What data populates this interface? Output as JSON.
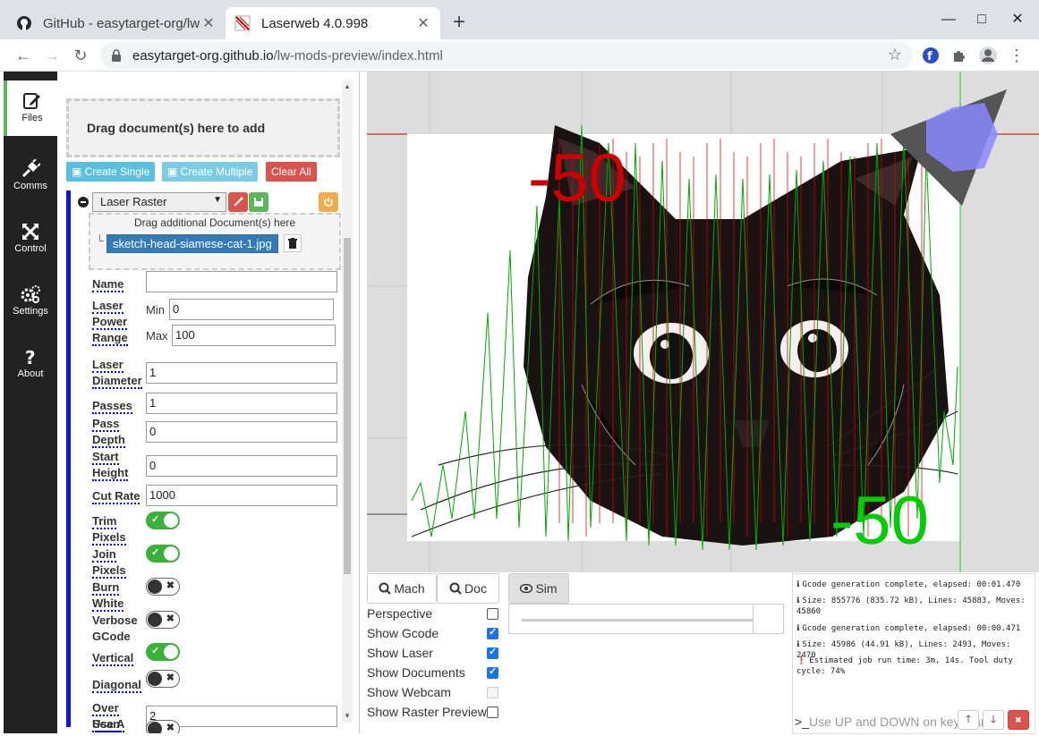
{
  "browser": {
    "tabs": [
      {
        "title": "GitHub - easytarget-org/lw-mods-preview",
        "active": false
      },
      {
        "title": "Laserweb 4.0.998",
        "active": true
      }
    ],
    "address_host": "easytarget-org.github.io",
    "address_path": "/lw-mods-preview/index.html"
  },
  "sidebar": {
    "items": [
      {
        "label": "Files",
        "icon": "file-edit-icon"
      },
      {
        "label": "Comms",
        "icon": "plug-icon"
      },
      {
        "label": "Control",
        "icon": "arrows-icon"
      },
      {
        "label": "Settings",
        "icon": "gears-icon"
      },
      {
        "label": "About",
        "icon": "question-icon"
      }
    ]
  },
  "files": {
    "dropzone_text": "Drag document(s) here to add",
    "create_single": "Create Single",
    "create_multiple": "Create Multiple",
    "clear_all": "Clear All"
  },
  "operation": {
    "type": "Laser Raster",
    "doc_drop_text": "Drag additional Document(s) here",
    "document": "sketch-head-siamese-cat-1.jpg",
    "fields": {
      "name": {
        "label": "Name",
        "value": ""
      },
      "laser_power_range": {
        "label_1": "Laser",
        "label_2": "Power",
        "label_3": "Range",
        "min_label": "Min",
        "min": "0",
        "max_label": "Max",
        "max": "100"
      },
      "laser_diameter": {
        "label_1": "Laser",
        "label_2": "Diameter",
        "value": "1"
      },
      "passes": {
        "label": "Passes",
        "value": "1"
      },
      "pass_depth": {
        "label_1": "Pass",
        "label_2": "Depth",
        "value": "0"
      },
      "start_height": {
        "label_1": "Start",
        "label_2": "Height",
        "value": "0"
      },
      "cut_rate": {
        "label": "Cut Rate",
        "value": "1000"
      },
      "trim_pixels": {
        "label_1": "Trim",
        "label_2": "Pixels",
        "on": true
      },
      "join_pixels": {
        "label_1": "Join",
        "label_2": "Pixels",
        "on": true
      },
      "burn_white": {
        "label_1": "Burn",
        "label_2": "White",
        "on": false
      },
      "verbose_gcode": {
        "label_1": "Verbose",
        "label_2": "GCode",
        "on": false
      },
      "vertical": {
        "label": "Vertical",
        "on": true
      },
      "diagonal": {
        "label": "Diagonal",
        "on": false
      },
      "over_scan": {
        "label_1": "Over",
        "label_2": "Scan",
        "value": "2"
      },
      "use_a": {
        "label": "Use A",
        "on": false
      }
    }
  },
  "workspace": {
    "axis_labels": {
      "y_label": "-50",
      "x_label": "-50"
    },
    "view_buttons": {
      "mach": "Mach",
      "doc": "Doc",
      "sim": "Sim"
    },
    "options": [
      {
        "label": "Perspective",
        "checked": false,
        "disabled": false
      },
      {
        "label": "Show Gcode",
        "checked": true,
        "disabled": false
      },
      {
        "label": "Show Laser",
        "checked": true,
        "disabled": false
      },
      {
        "label": "Show Documents",
        "checked": true,
        "disabled": false
      },
      {
        "label": "Show Webcam",
        "checked": false,
        "disabled": true
      },
      {
        "label": "Show Raster Preview",
        "checked": false,
        "disabled": false
      }
    ],
    "colors": {
      "x_axis": "#cc0000",
      "y_axis": "#00cc00",
      "toolpath": "#00aa00",
      "gcode_red": "#dd0000"
    }
  },
  "console": {
    "messages": [
      "Gcode generation complete, elapsed: 00:01.470",
      "Size: 855776 (835.72 kB), Lines: 45883, Moves: 45860",
      "Gcode generation complete, elapsed: 00:00.471",
      "Size: 45986 (44.91 kB), Lines: 2493, Moves: 2470",
      "Estimated job run time: 3m, 14s. Tool duty cycle: 74%"
    ],
    "input_placeholder": "Use UP and DOWN on keyboard"
  }
}
